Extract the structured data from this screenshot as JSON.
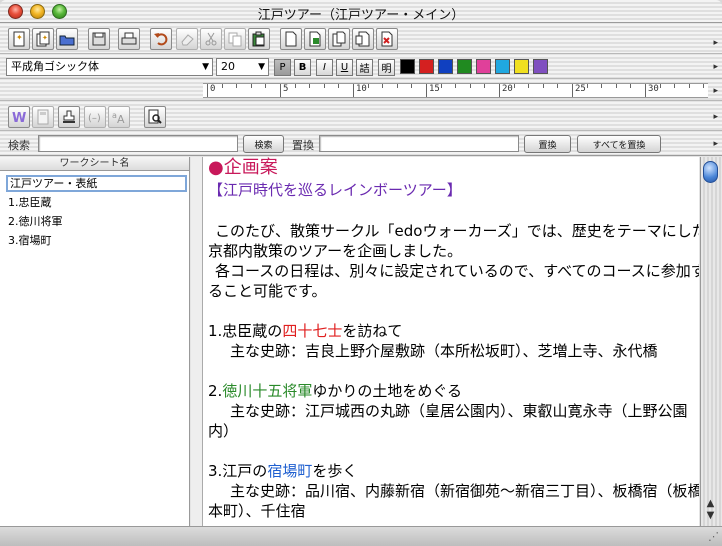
{
  "window": {
    "title": "江戸ツアー（江戸ツアー・メイン）"
  },
  "toolbar1": {
    "icons": [
      "new-doc-icon",
      "new-sheet-icon",
      "open-folder-icon",
      "save-icon",
      "print-icon",
      "undo-icon",
      "eraser-icon",
      "cut-icon",
      "copy-icon",
      "paste-icon",
      "page-icon",
      "page-add-icon",
      "page-copy-icon",
      "page-paste-icon",
      "page-delete-icon"
    ]
  },
  "format": {
    "font": "平成角ゴシック体",
    "size": "20",
    "buttons": {
      "plain": "P",
      "bold": "B",
      "italic": "I",
      "underline": "U",
      "ruby": "詰",
      "mincho": "明"
    },
    "colors": [
      "#000000",
      "#d42020",
      "#1040c0",
      "#208a20",
      "#e0409a",
      "#20a8e0",
      "#f0e020",
      "#8050c0"
    ]
  },
  "ruler": {
    "labels": [
      "0",
      "5",
      "10",
      "15",
      "20",
      "25",
      "30"
    ]
  },
  "search": {
    "label": "検索",
    "button": "検索",
    "replace_label": "置換",
    "replace_button": "置換",
    "replace_all_button": "すべてを置換"
  },
  "worksheets": {
    "header": "ワークシート名",
    "editing": "江戸ツアー・表紙",
    "items": [
      "1.忠臣蔵",
      "2.徳川将軍",
      "3.宿場町"
    ]
  },
  "document": {
    "title": "●企画案",
    "subtitle": "【江戸時代を巡るレインボーツアー】",
    "p1a": "このたび、散策サークル「edoウォーカーズ」では、歴史をテーマにした東",
    "p1b": "京都内散策のツアーを企画しました。",
    "p2a": "各コースの日程は、別々に設定されているので、すべてのコースに参加す",
    "p2b": "ること可能です。",
    "c1_pre": "1.忠臣蔵の",
    "c1_hl": "四十七士",
    "c1_post": "を訪ねて",
    "c1_sites": "主な史跡：吉良上野介屋敷跡（本所松坂町）、芝増上寺、永代橋",
    "c2_pre": "2.",
    "c2_hl": "徳川十五将軍",
    "c2_post": "ゆかりの土地をめぐる",
    "c2_sites": "主な史跡：江戸城西の丸跡（皇居公園内）、東叡山寛永寺（上野公園",
    "c2_sites2": "内）",
    "c3_pre": "3.江戸の",
    "c3_hl": "宿場町",
    "c3_post": "を歩く",
    "c3_sites": "主な史跡：品川宿、内藤新宿（新宿御苑〜新宿三丁目）、板橋宿（板橋",
    "c3_sites2": "本町）、千住宿"
  }
}
